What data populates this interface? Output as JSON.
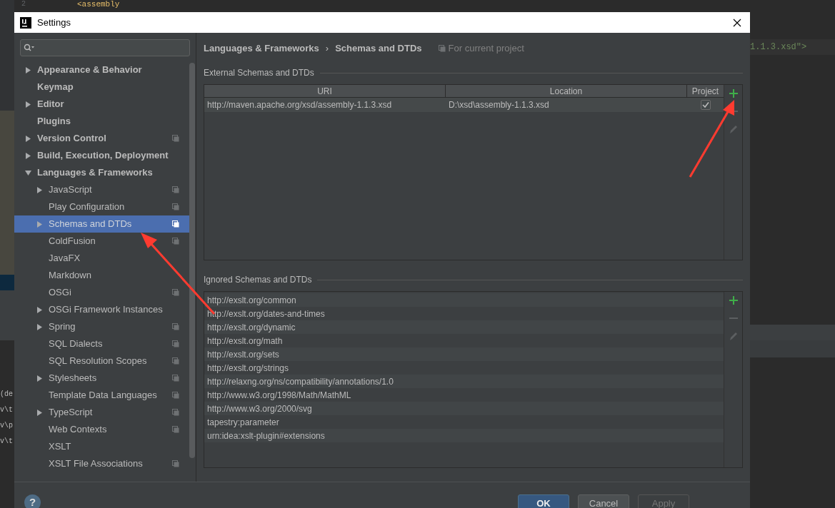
{
  "window": {
    "title": "Settings"
  },
  "editor_background": {
    "line_number": "2",
    "code_top": "<assembly",
    "code_right": "1.1.3.xsd\">",
    "console_lines": [
      "(de",
      "v\\t",
      "v\\p",
      "v\\t"
    ]
  },
  "sidebar": {
    "items": [
      {
        "label": "Appearance & Behavior",
        "kind": "node",
        "expanded": false,
        "project_level": false,
        "selected": false
      },
      {
        "label": "Keymap",
        "kind": "leaf",
        "project_level": false,
        "selected": false
      },
      {
        "label": "Editor",
        "kind": "node",
        "expanded": false,
        "project_level": false,
        "selected": false
      },
      {
        "label": "Plugins",
        "kind": "leaf",
        "project_level": false,
        "selected": false
      },
      {
        "label": "Version Control",
        "kind": "node",
        "expanded": false,
        "project_level": true,
        "selected": false
      },
      {
        "label": "Build, Execution, Deployment",
        "kind": "node",
        "expanded": false,
        "project_level": false,
        "selected": false
      },
      {
        "label": "Languages & Frameworks",
        "kind": "node",
        "expanded": true,
        "project_level": false,
        "selected": false,
        "children": [
          {
            "label": "JavaScript",
            "kind": "node",
            "expanded": false,
            "project_level": true,
            "selected": false
          },
          {
            "label": "Play Configuration",
            "kind": "leaf",
            "project_level": true,
            "selected": false
          },
          {
            "label": "Schemas and DTDs",
            "kind": "node",
            "expanded": false,
            "project_level": true,
            "selected": true
          },
          {
            "label": "ColdFusion",
            "kind": "leaf",
            "project_level": true,
            "selected": false
          },
          {
            "label": "JavaFX",
            "kind": "leaf",
            "project_level": false,
            "selected": false
          },
          {
            "label": "Markdown",
            "kind": "leaf",
            "project_level": false,
            "selected": false
          },
          {
            "label": "OSGi",
            "kind": "leaf",
            "project_level": true,
            "selected": false
          },
          {
            "label": "OSGi Framework Instances",
            "kind": "node",
            "expanded": false,
            "project_level": false,
            "selected": false
          },
          {
            "label": "Spring",
            "kind": "node",
            "expanded": false,
            "project_level": true,
            "selected": false
          },
          {
            "label": "SQL Dialects",
            "kind": "leaf",
            "project_level": true,
            "selected": false
          },
          {
            "label": "SQL Resolution Scopes",
            "kind": "leaf",
            "project_level": true,
            "selected": false
          },
          {
            "label": "Stylesheets",
            "kind": "node",
            "expanded": false,
            "project_level": true,
            "selected": false
          },
          {
            "label": "Template Data Languages",
            "kind": "leaf",
            "project_level": true,
            "selected": false
          },
          {
            "label": "TypeScript",
            "kind": "node",
            "expanded": false,
            "project_level": true,
            "selected": false
          },
          {
            "label": "Web Contexts",
            "kind": "leaf",
            "project_level": true,
            "selected": false
          },
          {
            "label": "XSLT",
            "kind": "leaf",
            "project_level": false,
            "selected": false
          },
          {
            "label": "XSLT File Associations",
            "kind": "leaf",
            "project_level": true,
            "selected": false
          }
        ]
      }
    ]
  },
  "breadcrumb": {
    "items": [
      "Languages & Frameworks",
      "Schemas and DTDs"
    ],
    "separator": "›",
    "scope_note": "For current project"
  },
  "external": {
    "title": "External Schemas and DTDs",
    "columns": [
      "URI",
      "Location",
      "Project"
    ],
    "rows": [
      {
        "uri": "http://maven.apache.org/xsd/assembly-1.1.3.xsd",
        "location": "D:\\xsd\\assembly-1.1.3.xsd",
        "project": true
      }
    ],
    "tools": [
      {
        "kind": "add",
        "disabled": false
      },
      {
        "kind": "remove",
        "disabled": true
      },
      {
        "kind": "edit",
        "disabled": true
      }
    ]
  },
  "ignored": {
    "title": "Ignored Schemas and DTDs",
    "rows": [
      "http://exslt.org/common",
      "http://exslt.org/dates-and-times",
      "http://exslt.org/dynamic",
      "http://exslt.org/math",
      "http://exslt.org/sets",
      "http://exslt.org/strings",
      "http://relaxng.org/ns/compatibility/annotations/1.0",
      "http://www.w3.org/1998/Math/MathML",
      "http://www.w3.org/2000/svg",
      "tapestry:parameter",
      "urn:idea:xslt-plugin#extensions"
    ],
    "tools": [
      {
        "kind": "add",
        "disabled": false
      },
      {
        "kind": "remove",
        "disabled": true
      },
      {
        "kind": "edit",
        "disabled": true
      }
    ]
  },
  "footer": {
    "help": "?",
    "buttons": [
      {
        "label": "OK",
        "kind": "default",
        "disabled": false
      },
      {
        "label": "Cancel",
        "kind": "normal",
        "disabled": false
      },
      {
        "label": "Apply",
        "kind": "normal",
        "disabled": true
      }
    ]
  }
}
